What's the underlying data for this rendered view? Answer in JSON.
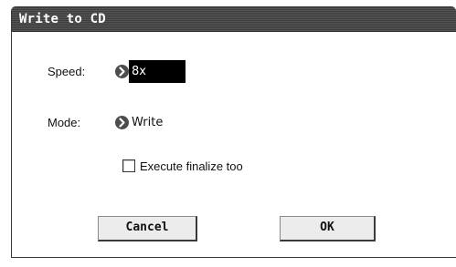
{
  "dialog": {
    "title": "Write to CD",
    "speed": {
      "label": "Speed:",
      "value": "8x"
    },
    "mode": {
      "label": "Mode:",
      "value": "Write"
    },
    "finalize_checkbox": {
      "label": "Execute finalize too",
      "checked": false
    },
    "buttons": {
      "cancel": "Cancel",
      "ok": "OK"
    }
  },
  "icons": {
    "popup_arrow": "chevron-right-icon"
  },
  "colors": {
    "titlebar": "#4a4a4a",
    "selected_field_bg": "#000000",
    "selected_field_text": "#ffffff"
  }
}
